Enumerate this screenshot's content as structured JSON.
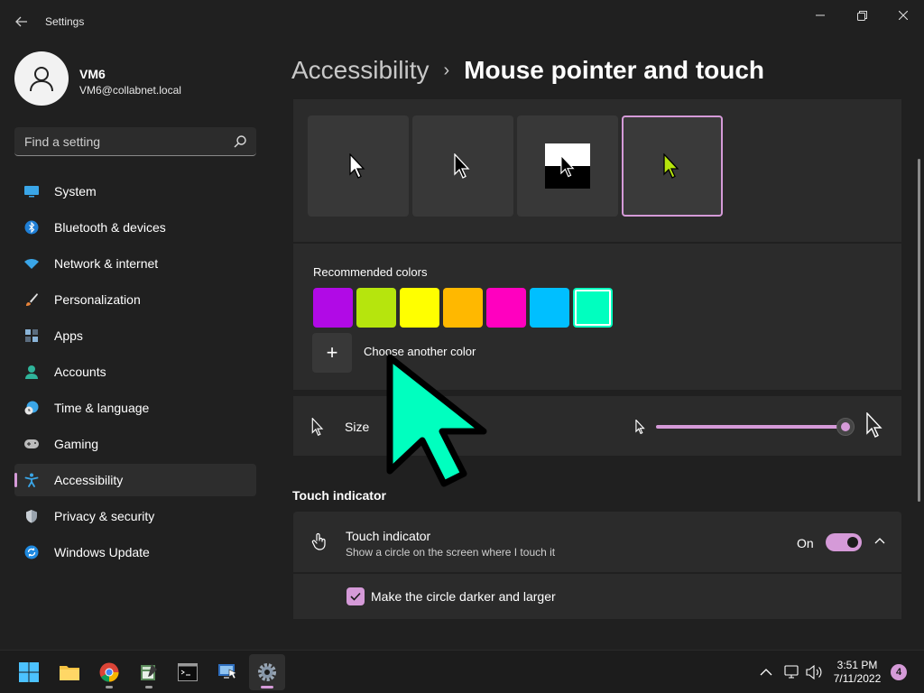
{
  "app": {
    "title": "Settings"
  },
  "window": {
    "back": "back-icon",
    "minimize": "minimize-icon",
    "maximize": "restore-icon",
    "close": "close-icon"
  },
  "profile": {
    "name": "VM6",
    "email": "VM6@collabnet.local"
  },
  "search": {
    "placeholder": "Find a setting"
  },
  "sidebar": {
    "items": [
      {
        "label": "System",
        "icon": "system-icon",
        "active": false
      },
      {
        "label": "Bluetooth & devices",
        "icon": "bluetooth-icon",
        "active": false
      },
      {
        "label": "Network & internet",
        "icon": "wifi-icon",
        "active": false
      },
      {
        "label": "Personalization",
        "icon": "brush-icon",
        "active": false
      },
      {
        "label": "Apps",
        "icon": "apps-icon",
        "active": false
      },
      {
        "label": "Accounts",
        "icon": "person-icon",
        "active": false
      },
      {
        "label": "Time & language",
        "icon": "globe-clock-icon",
        "active": false
      },
      {
        "label": "Gaming",
        "icon": "gamepad-icon",
        "active": false
      },
      {
        "label": "Accessibility",
        "icon": "accessibility-icon",
        "active": true
      },
      {
        "label": "Privacy & security",
        "icon": "shield-icon",
        "active": false
      },
      {
        "label": "Windows Update",
        "icon": "update-icon",
        "active": false
      }
    ]
  },
  "header": {
    "parent": "Accessibility",
    "separator": "›",
    "current": "Mouse pointer and touch"
  },
  "pointer_styles": {
    "options": [
      "white",
      "black",
      "inverted",
      "custom"
    ],
    "selected_index": 3
  },
  "colors": {
    "recommended_label": "Recommended colors",
    "swatches": [
      "#b10ae6",
      "#b6e50d",
      "#ffff00",
      "#ffb800",
      "#ff00bf",
      "#00bfff",
      "#00ffbf"
    ],
    "selected_index": 6,
    "add_symbol": "+",
    "add_label": "Choose another color",
    "accent": "#d59ad8"
  },
  "size": {
    "label": "Size",
    "value_fraction": 1.0
  },
  "touch_section": {
    "title": "Touch indicator"
  },
  "touch": {
    "title": "Touch indicator",
    "description": "Show a circle on the screen where I touch it",
    "toggle_label": "On",
    "toggle_on": true
  },
  "darker": {
    "label": "Make the circle darker and larger",
    "checked": true
  },
  "taskbar": {
    "apps": [
      "start-icon",
      "file-explorer-icon",
      "chrome-icon",
      "notepad-icon",
      "terminal-icon",
      "remote-desktop-icon",
      "settings-icon"
    ],
    "active_app": "settings-icon",
    "time": "3:51 PM",
    "date": "7/11/2022",
    "notifications": "4"
  }
}
